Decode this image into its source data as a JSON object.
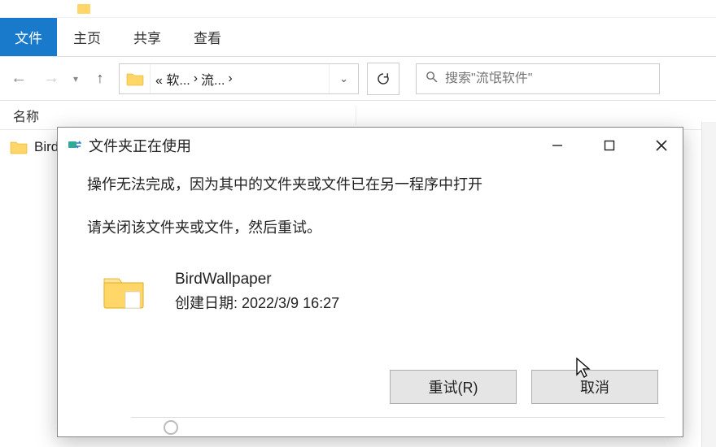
{
  "ribbon": {
    "file": "文件",
    "home": "主页",
    "share": "共享",
    "view": "查看"
  },
  "address": {
    "part1": "«  软...",
    "part2": "流...",
    "sep": "›"
  },
  "search_placeholder": "搜索\"流氓软件\"",
  "columns": {
    "name": "名称"
  },
  "files": [
    {
      "name": "Bird"
    }
  ],
  "dialog": {
    "title": "文件夹正在使用",
    "line1": "操作无法完成，因为其中的文件夹或文件已在另一程序中打开",
    "line2": "请关闭该文件夹或文件，然后重试。",
    "item_name": "BirdWallpaper",
    "item_date_label": "创建日期: 2022/3/9 16:27",
    "retry": "重试(R)",
    "cancel": "取消"
  }
}
